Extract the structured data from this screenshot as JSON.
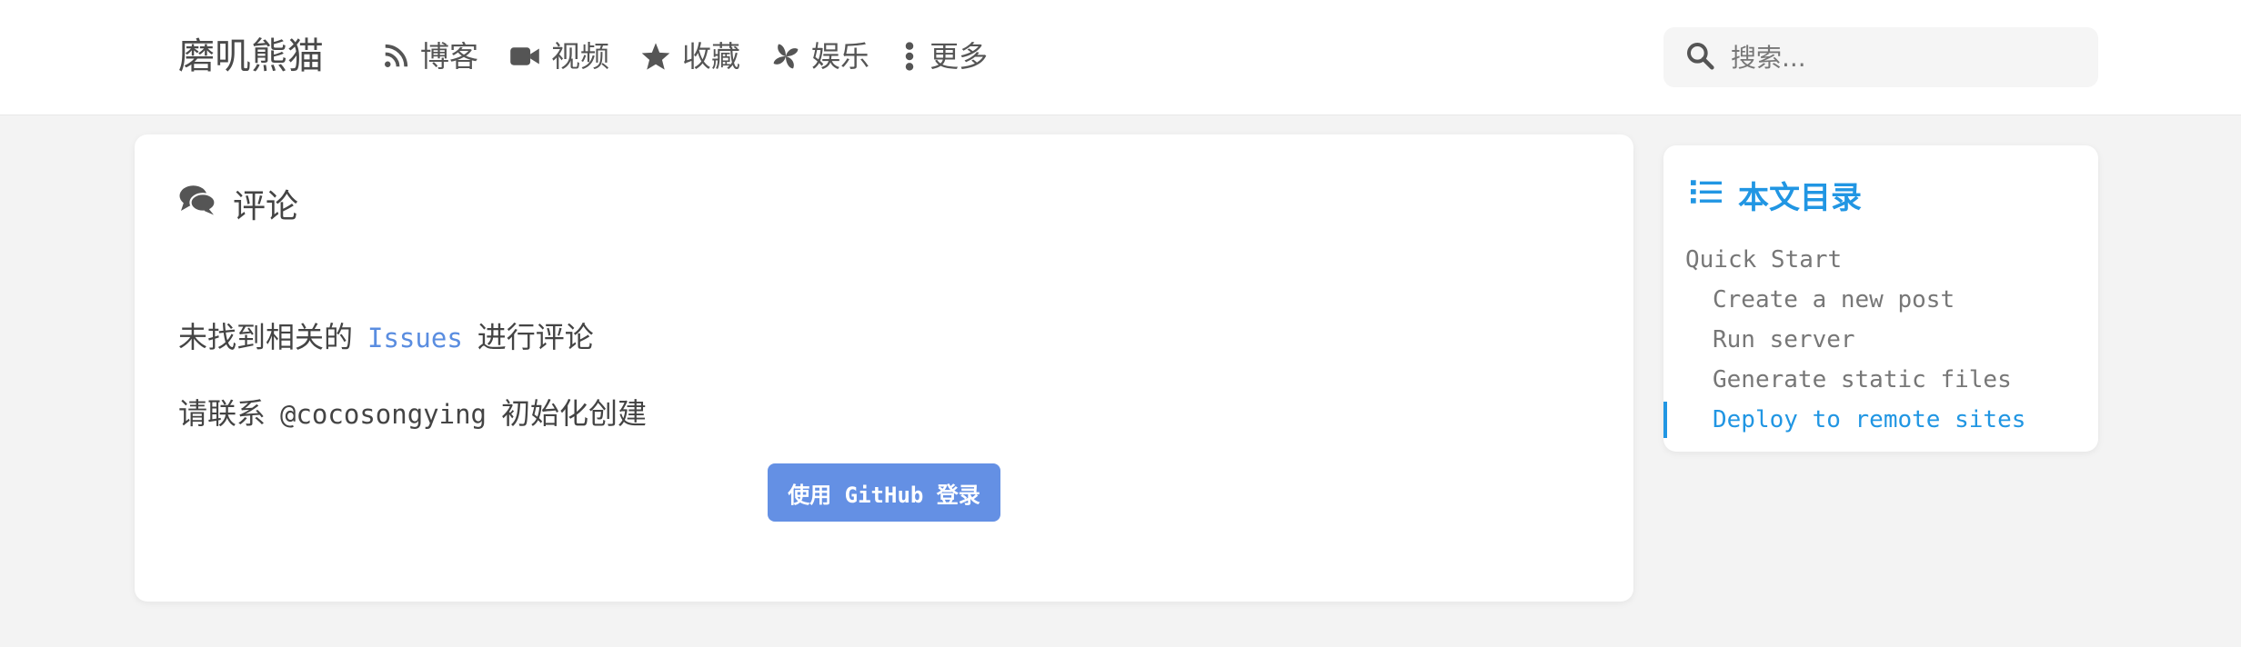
{
  "header": {
    "brand": "磨叽熊猫",
    "nav": [
      {
        "icon": "rss-icon",
        "label": "博客"
      },
      {
        "icon": "video-icon",
        "label": "视频"
      },
      {
        "icon": "star-icon",
        "label": "收藏"
      },
      {
        "icon": "pinwheel-icon",
        "label": "娱乐"
      },
      {
        "icon": "more-vertical-icon",
        "label": "更多"
      }
    ],
    "search": {
      "placeholder": "搜索..."
    }
  },
  "comments": {
    "title": "评论",
    "not_found_prefix": "未找到相关的",
    "issues_link": "Issues",
    "not_found_suffix": "进行评论",
    "contact_prefix": "请联系",
    "mention": "@cocosongying",
    "contact_suffix": "初始化创建",
    "login_button": "使用 GitHub 登录"
  },
  "toc": {
    "title": "本文目录",
    "items": [
      {
        "label": "Quick Start",
        "level": 1,
        "active": false
      },
      {
        "label": "Create a new post",
        "level": 2,
        "active": false
      },
      {
        "label": "Run server",
        "level": 2,
        "active": false
      },
      {
        "label": "Generate static files",
        "level": 2,
        "active": false
      },
      {
        "label": "Deploy to remote sites",
        "level": 2,
        "active": true
      }
    ]
  },
  "colors": {
    "accent": "#2196e3",
    "link": "#5a8de0",
    "button": "#6490e4"
  }
}
